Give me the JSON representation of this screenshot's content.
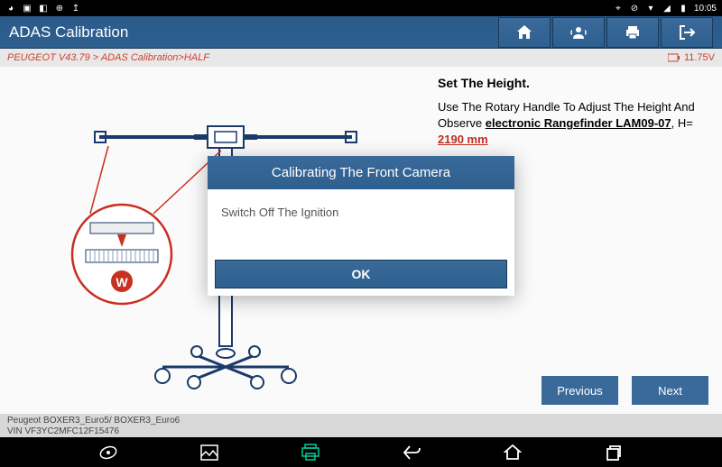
{
  "status_bar": {
    "time": "10:05"
  },
  "header": {
    "title": "ADAS Calibration"
  },
  "breadcrumb": {
    "path": "PEUGEOT V43.79 > ADAS Calibration>HALF",
    "voltage": "11.75V"
  },
  "info": {
    "title": "Set The Height.",
    "text_prefix": "Use The Rotary Handle To Adjust The Height And Observe ",
    "link_text": "electronic Rangefinder LAM09-07",
    "text_mid": ", H= ",
    "highlight": "2190 mm"
  },
  "buttons": {
    "previous": "Previous",
    "next": "Next"
  },
  "footer": {
    "line1": "Peugeot BOXER3_Euro5/ BOXER3_Euro6",
    "line2": "VIN VF3YC2MFC12F15476"
  },
  "modal": {
    "title": "Calibrating The Front Camera",
    "body": "Switch Off The Ignition",
    "ok": "OK"
  }
}
